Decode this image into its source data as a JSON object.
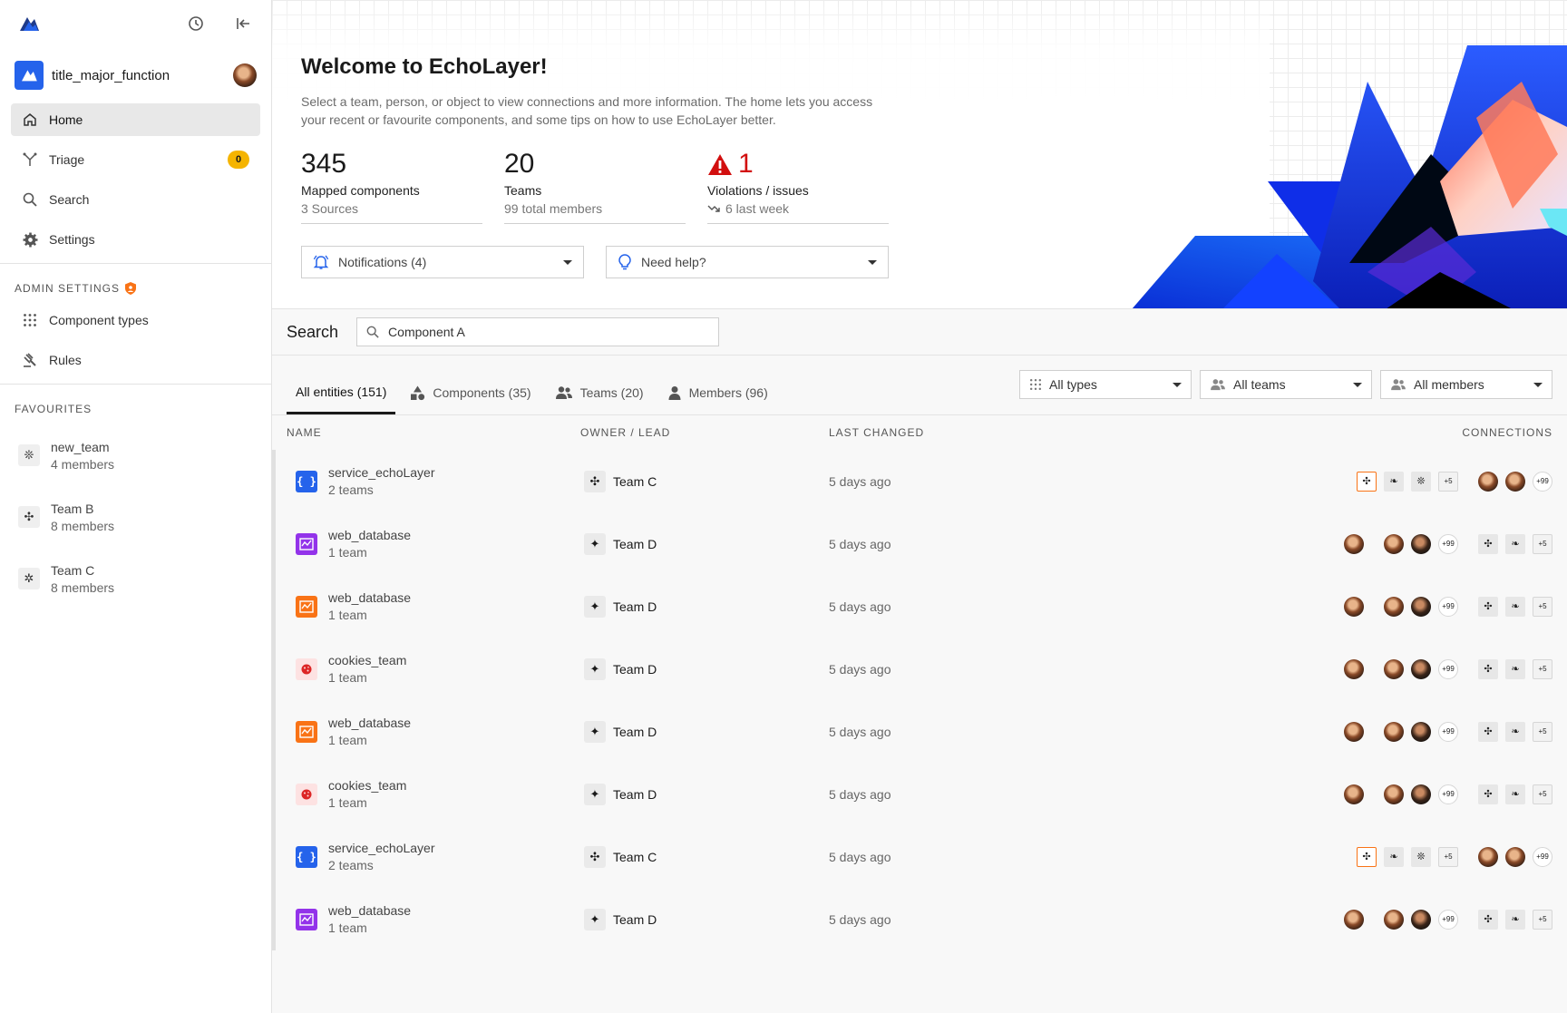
{
  "sidebar": {
    "workspace_name": "title_major_function",
    "nav": [
      {
        "label": "Home",
        "icon": "home-icon"
      },
      {
        "label": "Triage",
        "icon": "triage-icon",
        "badge": "0"
      },
      {
        "label": "Search",
        "icon": "search-icon"
      },
      {
        "label": "Settings",
        "icon": "gear-icon"
      }
    ],
    "admin_label": "ADMIN SETTINGS",
    "admin_items": [
      {
        "label": "Component types",
        "icon": "grid-icon"
      },
      {
        "label": "Rules",
        "icon": "gavel-icon"
      }
    ],
    "favourites_label": "FAVOURITES",
    "favourites": [
      {
        "name": "new_team",
        "sub": "4 members",
        "glyph": "❊"
      },
      {
        "name": "Team B",
        "sub": "8 members",
        "glyph": "✣"
      },
      {
        "name": "Team C",
        "sub": "8 members",
        "glyph": "✲"
      }
    ]
  },
  "hero": {
    "title": "Welcome to EchoLayer!",
    "description": "Select a team, person, or object to view connections and more information. The home lets you access your recent or favourite components, and some tips on how to use EchoLayer better.",
    "stats": [
      {
        "value": "345",
        "label": "Mapped components",
        "sub": "3 Sources"
      },
      {
        "value": "20",
        "label": "Teams",
        "sub": "99 total members"
      },
      {
        "value": "1",
        "label": "Violations / issues",
        "sub": "6 last week"
      }
    ],
    "notifications_label": "Notifications (4)",
    "help_label": "Need help?"
  },
  "search": {
    "label": "Search",
    "value": "Component A"
  },
  "tabs": [
    {
      "label": "All entities (151)"
    },
    {
      "label": "Components (35)"
    },
    {
      "label": "Teams (20)"
    },
    {
      "label": "Members (96)"
    }
  ],
  "filters": {
    "types": "All types",
    "teams": "All teams",
    "members": "All members"
  },
  "table": {
    "headers": {
      "name": "NAME",
      "owner": "OWNER / LEAD",
      "changed": "LAST CHANGED",
      "connections": "CONNECTIONS"
    },
    "rows": [
      {
        "name": "service_echoLayer",
        "sub": "2 teams",
        "kind": "blue",
        "owner": "Team C",
        "owner_glyph": "✣",
        "changed": "5 days ago",
        "pattern": "A"
      },
      {
        "name": "web_database",
        "sub": "1 team",
        "kind": "purple",
        "owner": "Team D",
        "owner_glyph": "✦",
        "changed": "5 days ago",
        "pattern": "B"
      },
      {
        "name": "web_database",
        "sub": "1 team",
        "kind": "orange",
        "owner": "Team D",
        "owner_glyph": "✦",
        "changed": "5 days ago",
        "pattern": "B"
      },
      {
        "name": "cookies_team",
        "sub": "1 team",
        "kind": "pink",
        "owner": "Team D",
        "owner_glyph": "✦",
        "changed": "5 days ago",
        "pattern": "B"
      },
      {
        "name": "web_database",
        "sub": "1 team",
        "kind": "orange",
        "owner": "Team D",
        "owner_glyph": "✦",
        "changed": "5 days ago",
        "pattern": "B"
      },
      {
        "name": "cookies_team",
        "sub": "1 team",
        "kind": "pink",
        "owner": "Team D",
        "owner_glyph": "✦",
        "changed": "5 days ago",
        "pattern": "B"
      },
      {
        "name": "service_echoLayer",
        "sub": "2 teams",
        "kind": "blue",
        "owner": "Team C",
        "owner_glyph": "✣",
        "changed": "5 days ago",
        "pattern": "A"
      },
      {
        "name": "web_database",
        "sub": "1 team",
        "kind": "purple",
        "owner": "Team D",
        "owner_glyph": "✦",
        "changed": "5 days ago",
        "pattern": "B"
      }
    ],
    "more_teams": "+5",
    "more_members": "+99"
  },
  "colors": {
    "accent_blue": "#2563eb",
    "badge_yellow": "#f5b400",
    "violation_red": "#d20f0f",
    "selected_orange": "#f97316"
  }
}
